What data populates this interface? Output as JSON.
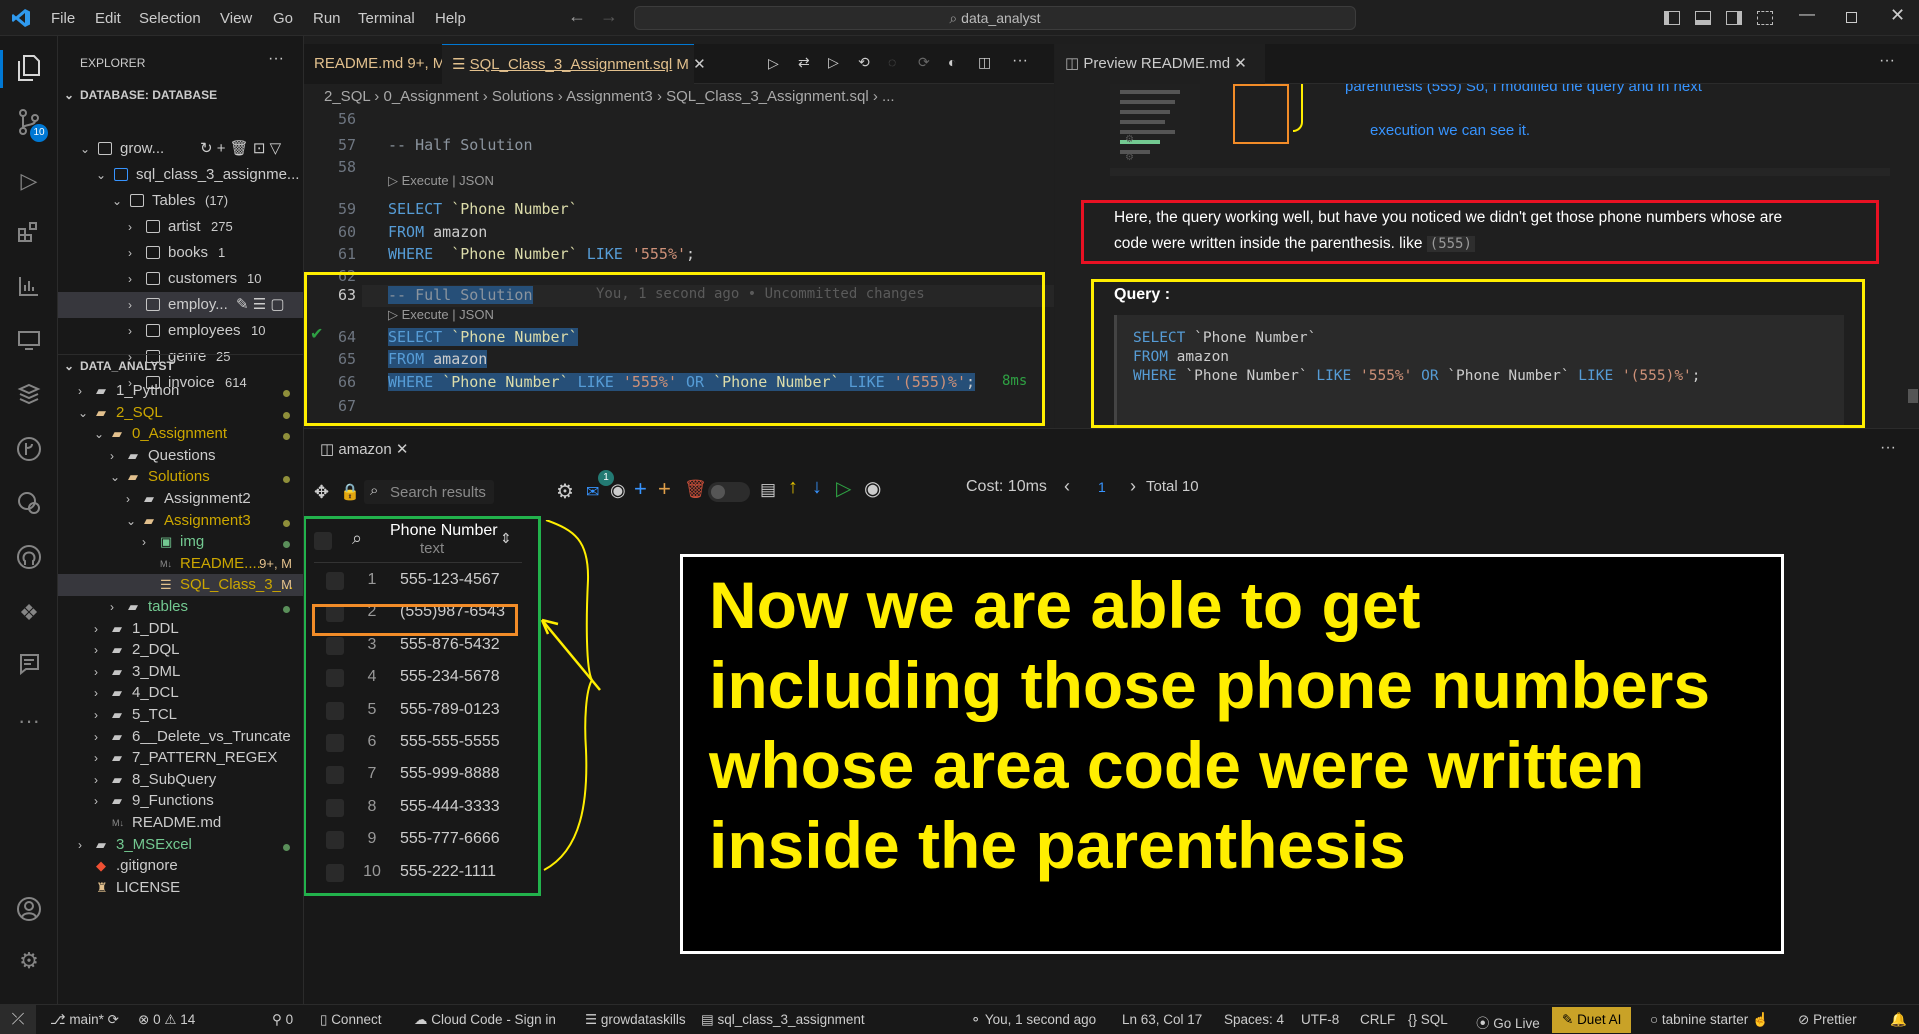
{
  "titlebar": {
    "menus": [
      "File",
      "Edit",
      "Selection",
      "View",
      "Go",
      "Run",
      "Terminal",
      "Help"
    ],
    "search": "data_analyst"
  },
  "activity": {
    "scm_badge": "10"
  },
  "sidebar": {
    "title": "EXPLORER",
    "db_section": "DATABASE: DATABASE",
    "db_items": [
      {
        "label": "grow...",
        "indent": 1
      },
      {
        "label": "sql_class_3_assignme...",
        "indent": 2
      },
      {
        "label": "Tables",
        "count": "(17)",
        "indent": 3
      },
      {
        "label": "artist",
        "count": "275",
        "indent": 4
      },
      {
        "label": "books",
        "count": "1",
        "indent": 4
      },
      {
        "label": "customers",
        "count": "10",
        "indent": 4
      },
      {
        "label": "employ...",
        "count": "",
        "indent": 4
      },
      {
        "label": "employees",
        "count": "10",
        "indent": 4
      },
      {
        "label": "genre",
        "count": "25",
        "indent": 4
      },
      {
        "label": "invoice",
        "count": "614",
        "indent": 4
      }
    ],
    "ws_section": "DATA_ANALYST",
    "ws_items": [
      {
        "label": "1_Python",
        "indent": 1,
        "kind": "folder",
        "color": "#cccccc",
        "dot": true
      },
      {
        "label": "2_SQL",
        "indent": 1,
        "kind": "folder-open",
        "color": "#cca700",
        "dot": true
      },
      {
        "label": "0_Assignment",
        "indent": 2,
        "kind": "folder-open",
        "color": "#cca700",
        "dot": true
      },
      {
        "label": "Questions",
        "indent": 3,
        "kind": "folder",
        "color": "#cccccc",
        "dot": false
      },
      {
        "label": "Solutions",
        "indent": 3,
        "kind": "folder-open",
        "color": "#cca700",
        "dot": true
      },
      {
        "label": "Assignment2",
        "indent": 4,
        "kind": "folder",
        "color": "#cccccc",
        "dot": false
      },
      {
        "label": "Assignment3",
        "indent": 4,
        "kind": "folder-open",
        "color": "#cca700",
        "dot": true
      },
      {
        "label": "img",
        "indent": 5,
        "kind": "img",
        "color": "#73c991",
        "dot": true
      },
      {
        "label": "README....",
        "indent": 5,
        "kind": "md",
        "color": "#cca700",
        "badge": "9+, M"
      },
      {
        "label": "SQL_Class_3_...",
        "indent": 5,
        "kind": "sql",
        "color": "#cca700",
        "badge": "M"
      },
      {
        "label": "tables",
        "indent": 3,
        "kind": "folder",
        "color": "#73c991",
        "dot": true
      },
      {
        "label": "1_DDL",
        "indent": 2,
        "kind": "folder",
        "color": "#cccccc",
        "dot": false
      },
      {
        "label": "2_DQL",
        "indent": 2,
        "kind": "folder",
        "color": "#cccccc",
        "dot": false
      },
      {
        "label": "3_DML",
        "indent": 2,
        "kind": "folder",
        "color": "#cccccc",
        "dot": false
      },
      {
        "label": "4_DCL",
        "indent": 2,
        "kind": "folder",
        "color": "#cccccc",
        "dot": false
      },
      {
        "label": "5_TCL",
        "indent": 2,
        "kind": "folder",
        "color": "#cccccc",
        "dot": false
      },
      {
        "label": "6__Delete_vs_Truncate",
        "indent": 2,
        "kind": "folder",
        "color": "#cccccc",
        "dot": false
      },
      {
        "label": "7_PATTERN_REGEX",
        "indent": 2,
        "kind": "folder",
        "color": "#cccccc",
        "dot": false
      },
      {
        "label": "8_SubQuery",
        "indent": 2,
        "kind": "folder",
        "color": "#cccccc",
        "dot": false
      },
      {
        "label": "9_Functions",
        "indent": 2,
        "kind": "folder",
        "color": "#cccccc",
        "dot": false
      },
      {
        "label": "README.md",
        "indent": 2,
        "kind": "md",
        "color": "#cccccc",
        "dot": false
      },
      {
        "label": "3_MSExcel",
        "indent": 1,
        "kind": "folder",
        "color": "#73c991",
        "dot": true
      },
      {
        "label": ".gitignore",
        "indent": 1,
        "kind": "git",
        "color": "#cccccc",
        "dot": false
      },
      {
        "label": "LICENSE",
        "indent": 1,
        "kind": "lic",
        "color": "#cccccc",
        "dot": false
      }
    ]
  },
  "editor": {
    "tabs": [
      {
        "label": "README.md",
        "badge": "9+, M"
      },
      {
        "label": "SQL_Class_3_Assignment.sql",
        "badge": "M"
      }
    ],
    "breadcrumb": "2_SQL  ›  0_Assignment  ›  Solutions  ›  Assignment3  ›  SQL_Class_3_Assignment.sql  ›  ...",
    "lens": "Execute | JSON",
    "line_numbers": [
      "56",
      "57",
      "58",
      "59",
      "60",
      "61",
      "62",
      "63",
      "64",
      "65",
      "66",
      "67"
    ],
    "comment_half": "-- Half Solution",
    "comment_full": "-- Full Solution",
    "blame": "You, 1 second ago • Uncommitted changes",
    "kw_select": "SELECT",
    "kw_from": "FROM",
    "kw_where": "WHERE",
    "kw_like": "LIKE",
    "kw_or": "OR",
    "col": "`Phone Number`",
    "table": "amazon",
    "pat1": "'555%'",
    "pat2": "'(555)%'",
    "semi": ";",
    "elapsed": "8ms"
  },
  "preview": {
    "tab": "Preview README.md",
    "top_text_1": "parenthesis  (555)   So, I modified the query and in next",
    "top_text_2": "execution we can see it.",
    "note_1": "Here, the query working well, but have you noticed we didn't get those phone numbers whose are",
    "note_2": "code were written inside the parenthesis. like",
    "note_code": "(555)",
    "query_heading": "Query :"
  },
  "panel": {
    "tab": "amazon",
    "search_placeholder": "Search results",
    "mail_badge": "1",
    "cost": "Cost: 10ms",
    "page": "1",
    "total": "Total 10",
    "column": "Phone Number",
    "column_type": "text",
    "rows": [
      {
        "n": "1",
        "v": "555-123-4567"
      },
      {
        "n": "2",
        "v": "(555)987-6543"
      },
      {
        "n": "3",
        "v": "555-876-5432"
      },
      {
        "n": "4",
        "v": "555-234-5678"
      },
      {
        "n": "5",
        "v": "555-789-0123"
      },
      {
        "n": "6",
        "v": "555-555-5555"
      },
      {
        "n": "7",
        "v": "555-999-8888"
      },
      {
        "n": "8",
        "v": "555-444-3333"
      },
      {
        "n": "9",
        "v": "555-777-6666"
      },
      {
        "n": "10",
        "v": "555-222-1111"
      }
    ],
    "annotation_lines": [
      "Now we are able to get",
      "including those phone numbers",
      "whose area code were written",
      "inside the parenthesis"
    ]
  },
  "status": {
    "branch": "main*",
    "problems": "0",
    "warnings": "14",
    "ports": "0",
    "connect": "Connect",
    "cloud": "Cloud Code - Sign in",
    "db": "growdataskills",
    "schema": "sql_class_3_assignment",
    "blame": "You, 1 second ago",
    "position": "Ln 63, Col 17",
    "spaces": "Spaces: 4",
    "encoding": "UTF-8",
    "eol": "CRLF",
    "lang": "SQL",
    "golive": "Go Live",
    "duet": "Duet AI",
    "tabnine": "tabnine starter",
    "prettier": "Prettier"
  },
  "colors": {
    "annotation_yellow": "#ffee00",
    "box_green": "#22b24c",
    "box_orange": "#f28c28",
    "box_red": "#e81123",
    "accent_blue": "#0078d4"
  }
}
